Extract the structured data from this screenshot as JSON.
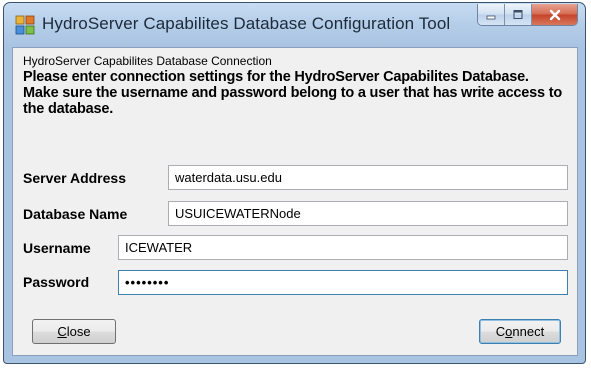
{
  "window": {
    "title": "HydroServer Capabilites Database Configuration Tool"
  },
  "connection": {
    "group_label": "HydroServer Capabilites Database Connection",
    "instructions": "Please enter connection settings for the HydroServer Capabilites Database. Make sure the username and password belong to a user that has write access to the database."
  },
  "fields": {
    "server_address": {
      "label": "Server Address",
      "value": "waterdata.usu.edu"
    },
    "database_name": {
      "label": "Database Name",
      "value": "USUICEWATERNode"
    },
    "username": {
      "label": "Username",
      "value": "ICEWATER"
    },
    "password": {
      "label": "Password",
      "value": "••••••••"
    }
  },
  "buttons": {
    "close": {
      "mnemonic": "C",
      "rest": "lose"
    },
    "connect": {
      "first": "C",
      "mnemonic": "o",
      "rest": "nnect"
    }
  }
}
